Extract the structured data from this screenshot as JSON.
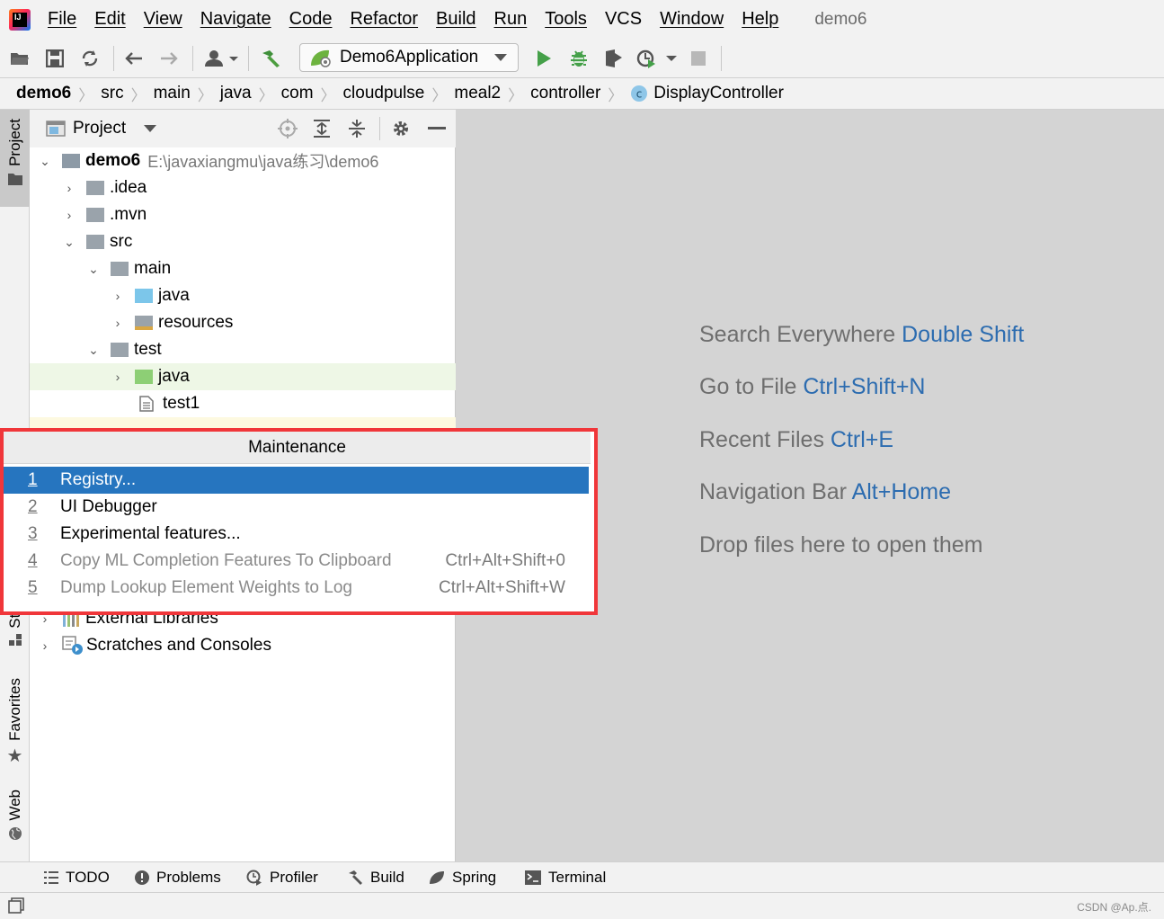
{
  "menubar": {
    "items": [
      "File",
      "Edit",
      "View",
      "Navigate",
      "Code",
      "Refactor",
      "Build",
      "Run",
      "Tools",
      "VCS",
      "Window",
      "Help"
    ],
    "project_title": "demo6"
  },
  "toolbar": {
    "run_config": "Demo6Application"
  },
  "breadcrumb": [
    "demo6",
    "src",
    "main",
    "java",
    "com",
    "cloudpulse",
    "meal2",
    "controller",
    "DisplayController"
  ],
  "left_strip": {
    "project": "Project",
    "structure": "Str",
    "favorites": "Favorites",
    "web": "Web"
  },
  "project_panel": {
    "header": "Project",
    "root_name": "demo6",
    "root_path": "E:\\javaxiangmu\\java练习\\demo6",
    "tree": [
      ".idea",
      ".mvn",
      "src",
      "main",
      "java",
      "resources",
      "test",
      "java",
      "test1"
    ],
    "external_libraries": "External Libraries",
    "scratches": "Scratches and Consoles"
  },
  "popup": {
    "title": "Maintenance",
    "items": [
      {
        "num": "1",
        "label": "Registry...",
        "shortcut": ""
      },
      {
        "num": "2",
        "label": "UI Debugger",
        "shortcut": ""
      },
      {
        "num": "3",
        "label": "Experimental features...",
        "shortcut": ""
      },
      {
        "num": "4",
        "label": "Copy ML Completion Features To Clipboard",
        "shortcut": "Ctrl+Alt+Shift+0"
      },
      {
        "num": "5",
        "label": "Dump Lookup Element Weights to Log",
        "shortcut": "Ctrl+Alt+Shift+W"
      }
    ]
  },
  "editor_tips": [
    {
      "text": "Search Everywhere",
      "key": "Double Shift"
    },
    {
      "text": "Go to File",
      "key": "Ctrl+Shift+N"
    },
    {
      "text": "Recent Files",
      "key": "Ctrl+E"
    },
    {
      "text": "Navigation Bar",
      "key": "Alt+Home"
    },
    {
      "text": "Drop files here to open them",
      "key": ""
    }
  ],
  "bottom_tabs": [
    "TODO",
    "Problems",
    "Profiler",
    "Build",
    "Spring",
    "Terminal"
  ],
  "watermark": "CSDN @Ap.点."
}
